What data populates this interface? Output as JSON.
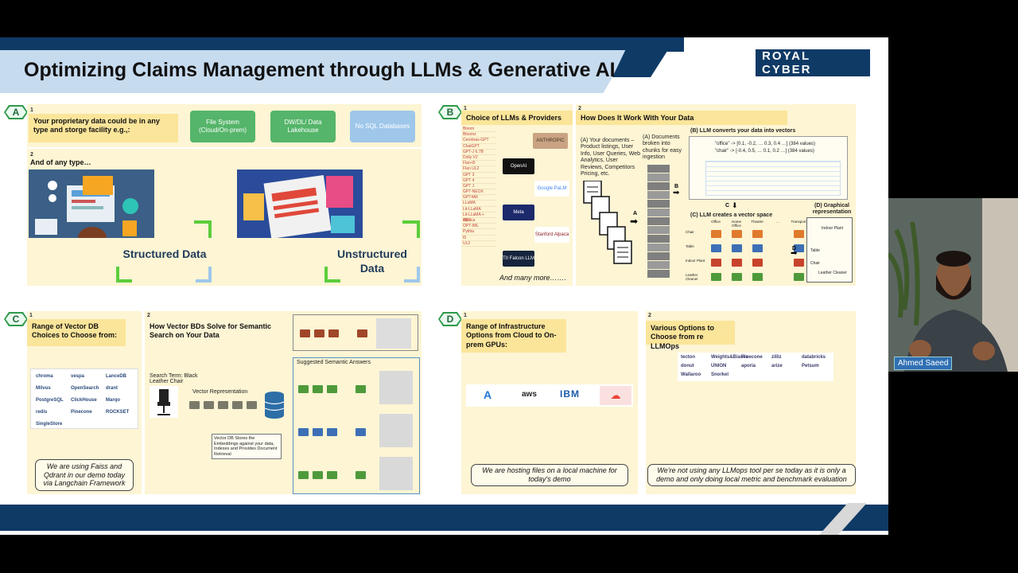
{
  "slide": {
    "title": "Optimizing Claims Management through LLMs & Generative AI",
    "logo": "ROYAL CYBER"
  },
  "panel_a": {
    "badge": "A",
    "n1": "1",
    "n2": "2",
    "hdr1": "Your proprietary data could be in any type and storge facility e.g.,:",
    "tag_fs": "File System (Cloud/On-prem)",
    "tag_dw": "DW/DL/ Data Lakehouse",
    "tag_nosql": "No SQL Databases",
    "any_type": "And of any type…",
    "structured": "Structured Data",
    "unstructured": "Unstructured Data"
  },
  "panel_b": {
    "badge": "B",
    "n1": "1",
    "n2": "2",
    "hdr1": "Choice of LLMs & Providers",
    "hdr2": "How Does It Work With Your Data",
    "llm_list": [
      "Bloom",
      "Bloomz",
      "Cerebras-GPT",
      "ChatGPT",
      "GPT-J 6.7B",
      "Dolly V2",
      "Flan-t5",
      "Flan UL2",
      "GPT 3",
      "GPT 4",
      "GPT J",
      "GPT-NEOX",
      "GPT4All",
      "LLaMA",
      "Lit-LLaMA",
      "Lit-LLaMA + Alpaca",
      "OPT",
      "OPT-IML",
      "Pythia",
      "t5",
      "UL2"
    ],
    "vendors": [
      "ANTHROPIC",
      "OpenAI",
      "Google PaLM",
      "Meta",
      "Stanford Alpaca",
      "TII Falcon LLM"
    ],
    "and_more": "And many more…….",
    "docs_text": "(A) Your documents – Product listings, User Info, User Queries, Web Analytics, User Reviews, Competitors Pricing, etc.",
    "chunks_text": "(A) Documents broken into chunks for easy ingestion",
    "vectors_title": "(B) LLM converts your data into vectors",
    "vec_office": "\"office\" -> [0.1, -0.2, … 0.3, 0.4 …] (384 values)",
    "vec_chair": "\"chair\" -> [-0.4, 0.5, … 0.1, 0.2 …] (384 values)",
    "vs_title": "(C) LLM creates a vector space",
    "graph_title": "(D) Graphical representation",
    "graph_labels": [
      "Indoor Plant",
      "Table",
      "Chair",
      "Leather Cleaner"
    ],
    "row_labels": [
      "Chair",
      "Table",
      "Indoor Plant",
      "Leather Cleaner"
    ],
    "col_labels": [
      "Office",
      "Home Office",
      "Theatre",
      "…",
      "Transport"
    ],
    "marker_a": "A",
    "marker_b": "B",
    "marker_c": "C",
    "marker_d": "D"
  },
  "panel_c": {
    "badge": "C",
    "n1": "1",
    "n2": "2",
    "hdr1": "Range of Vector DB Choices to Choose from:",
    "hdr2": "How Vector BDs Solve for Semantic Search on Your Data",
    "db_logos": [
      "chroma",
      "vespa",
      "LanceDB",
      "Milvus",
      "OpenSearch",
      "drant",
      "PostgreSQL",
      "ClickHouse",
      "Marqo",
      "redis",
      "Pinecone",
      "ROCKSET",
      "SingleStore"
    ],
    "search_term": "Search Term: Black Leather Chair",
    "vec_rep": "Vector Representation",
    "vdb_note": "Vector DB Stores the Embeddings against your data, Indexes and Provides Document Retrieval",
    "suggested": "Suggested Semantic Answers",
    "note": "We are using Faiss and Qdrant in our demo today via Langchain Framework"
  },
  "panel_d": {
    "badge": "D",
    "n1": "1",
    "n2": "2",
    "hdr1": "Range of Infrastructure Options from Cloud to On-prem GPUs:",
    "hdr2": "Various Options to Choose from re LLMOps",
    "clouds": [
      "A",
      "aws",
      "IBM",
      "☁"
    ],
    "llmops": [
      "tecton",
      "Weights&Biases",
      "Pinecone",
      "zilliz",
      "databricks",
      "donut",
      "UNION",
      "aporia",
      "arize",
      "Petsum",
      "Wallaroo",
      "Snorkel"
    ],
    "note1": "We are hosting files on a local machine for today's demo",
    "note2": "We're not using any LLMops tool per se today as it is only a demo and only doing local metric and benchmark evaluation"
  },
  "presenter": {
    "name": "Ahmed Saeed"
  },
  "colors": {
    "navy": "#0f3a66",
    "green": "#55b56a",
    "sky": "#9fc7ea",
    "panel": "#fdf5d4",
    "header": "#fbe59a"
  }
}
